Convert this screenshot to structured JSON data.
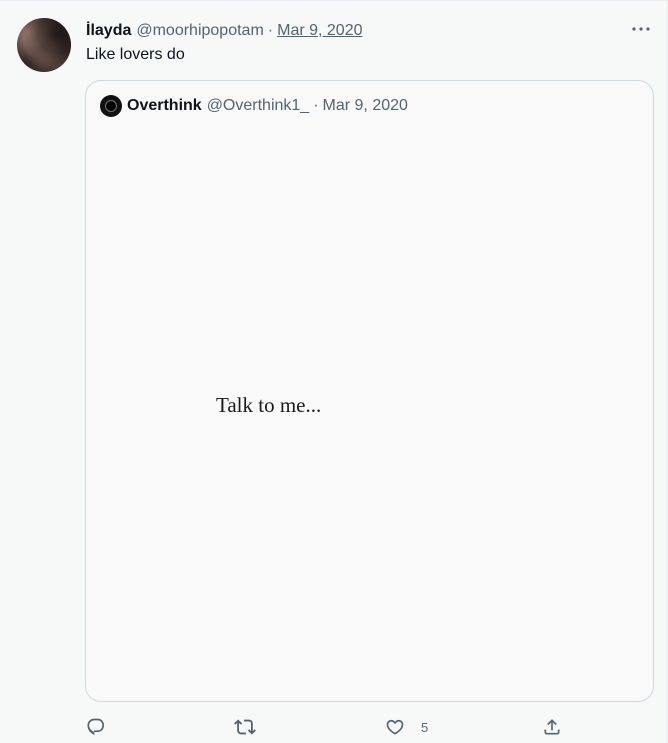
{
  "tweet": {
    "author_name": "İlayda",
    "author_handle": "@moorhipopotam",
    "separator": "·",
    "date": "Mar 9, 2020",
    "text": "Like lovers do"
  },
  "quote": {
    "author_name": "Overthink",
    "author_handle": "@Overthink1_",
    "separator": "·",
    "date": "Mar 9, 2020",
    "image_text": "Talk to me..."
  },
  "actions": {
    "reply_icon": "reply-icon",
    "retweet_icon": "retweet-icon",
    "like_icon": "heart-icon",
    "like_count": "5",
    "share_icon": "share-icon"
  },
  "colors": {
    "secondary_text": "#536471",
    "primary_text": "#0f1419",
    "border": "#cfd9de",
    "background": "#f7f9f9"
  }
}
